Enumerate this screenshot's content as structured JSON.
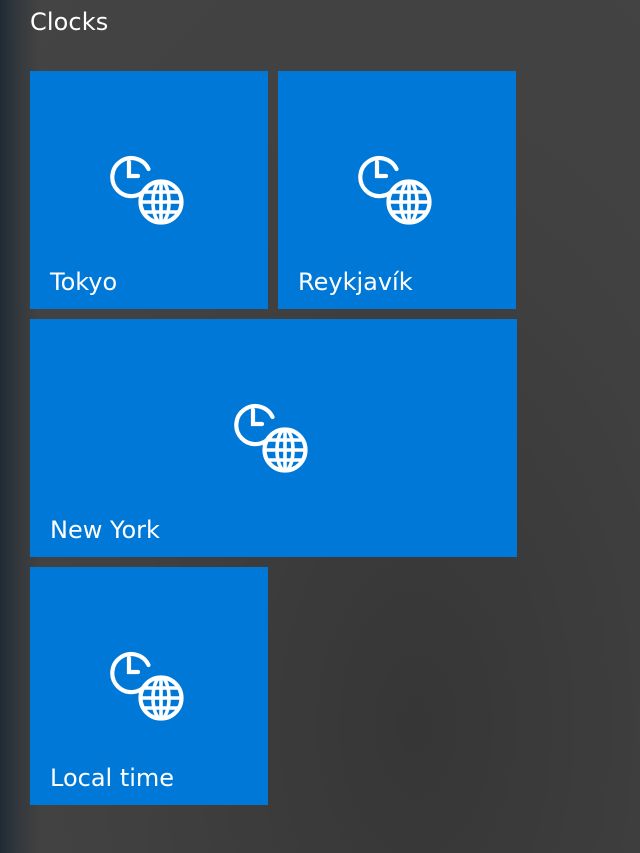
{
  "group": {
    "title": "Clocks"
  },
  "tiles": [
    {
      "label": "Tokyo",
      "icon": "world-clock-icon"
    },
    {
      "label": "Reykjavík",
      "icon": "world-clock-icon"
    },
    {
      "label": "New York",
      "icon": "world-clock-icon"
    },
    {
      "label": "Local time",
      "icon": "world-clock-icon"
    }
  ],
  "colors": {
    "tile_accent": "#0078d7",
    "background": "#444444",
    "text": "#ffffff"
  }
}
